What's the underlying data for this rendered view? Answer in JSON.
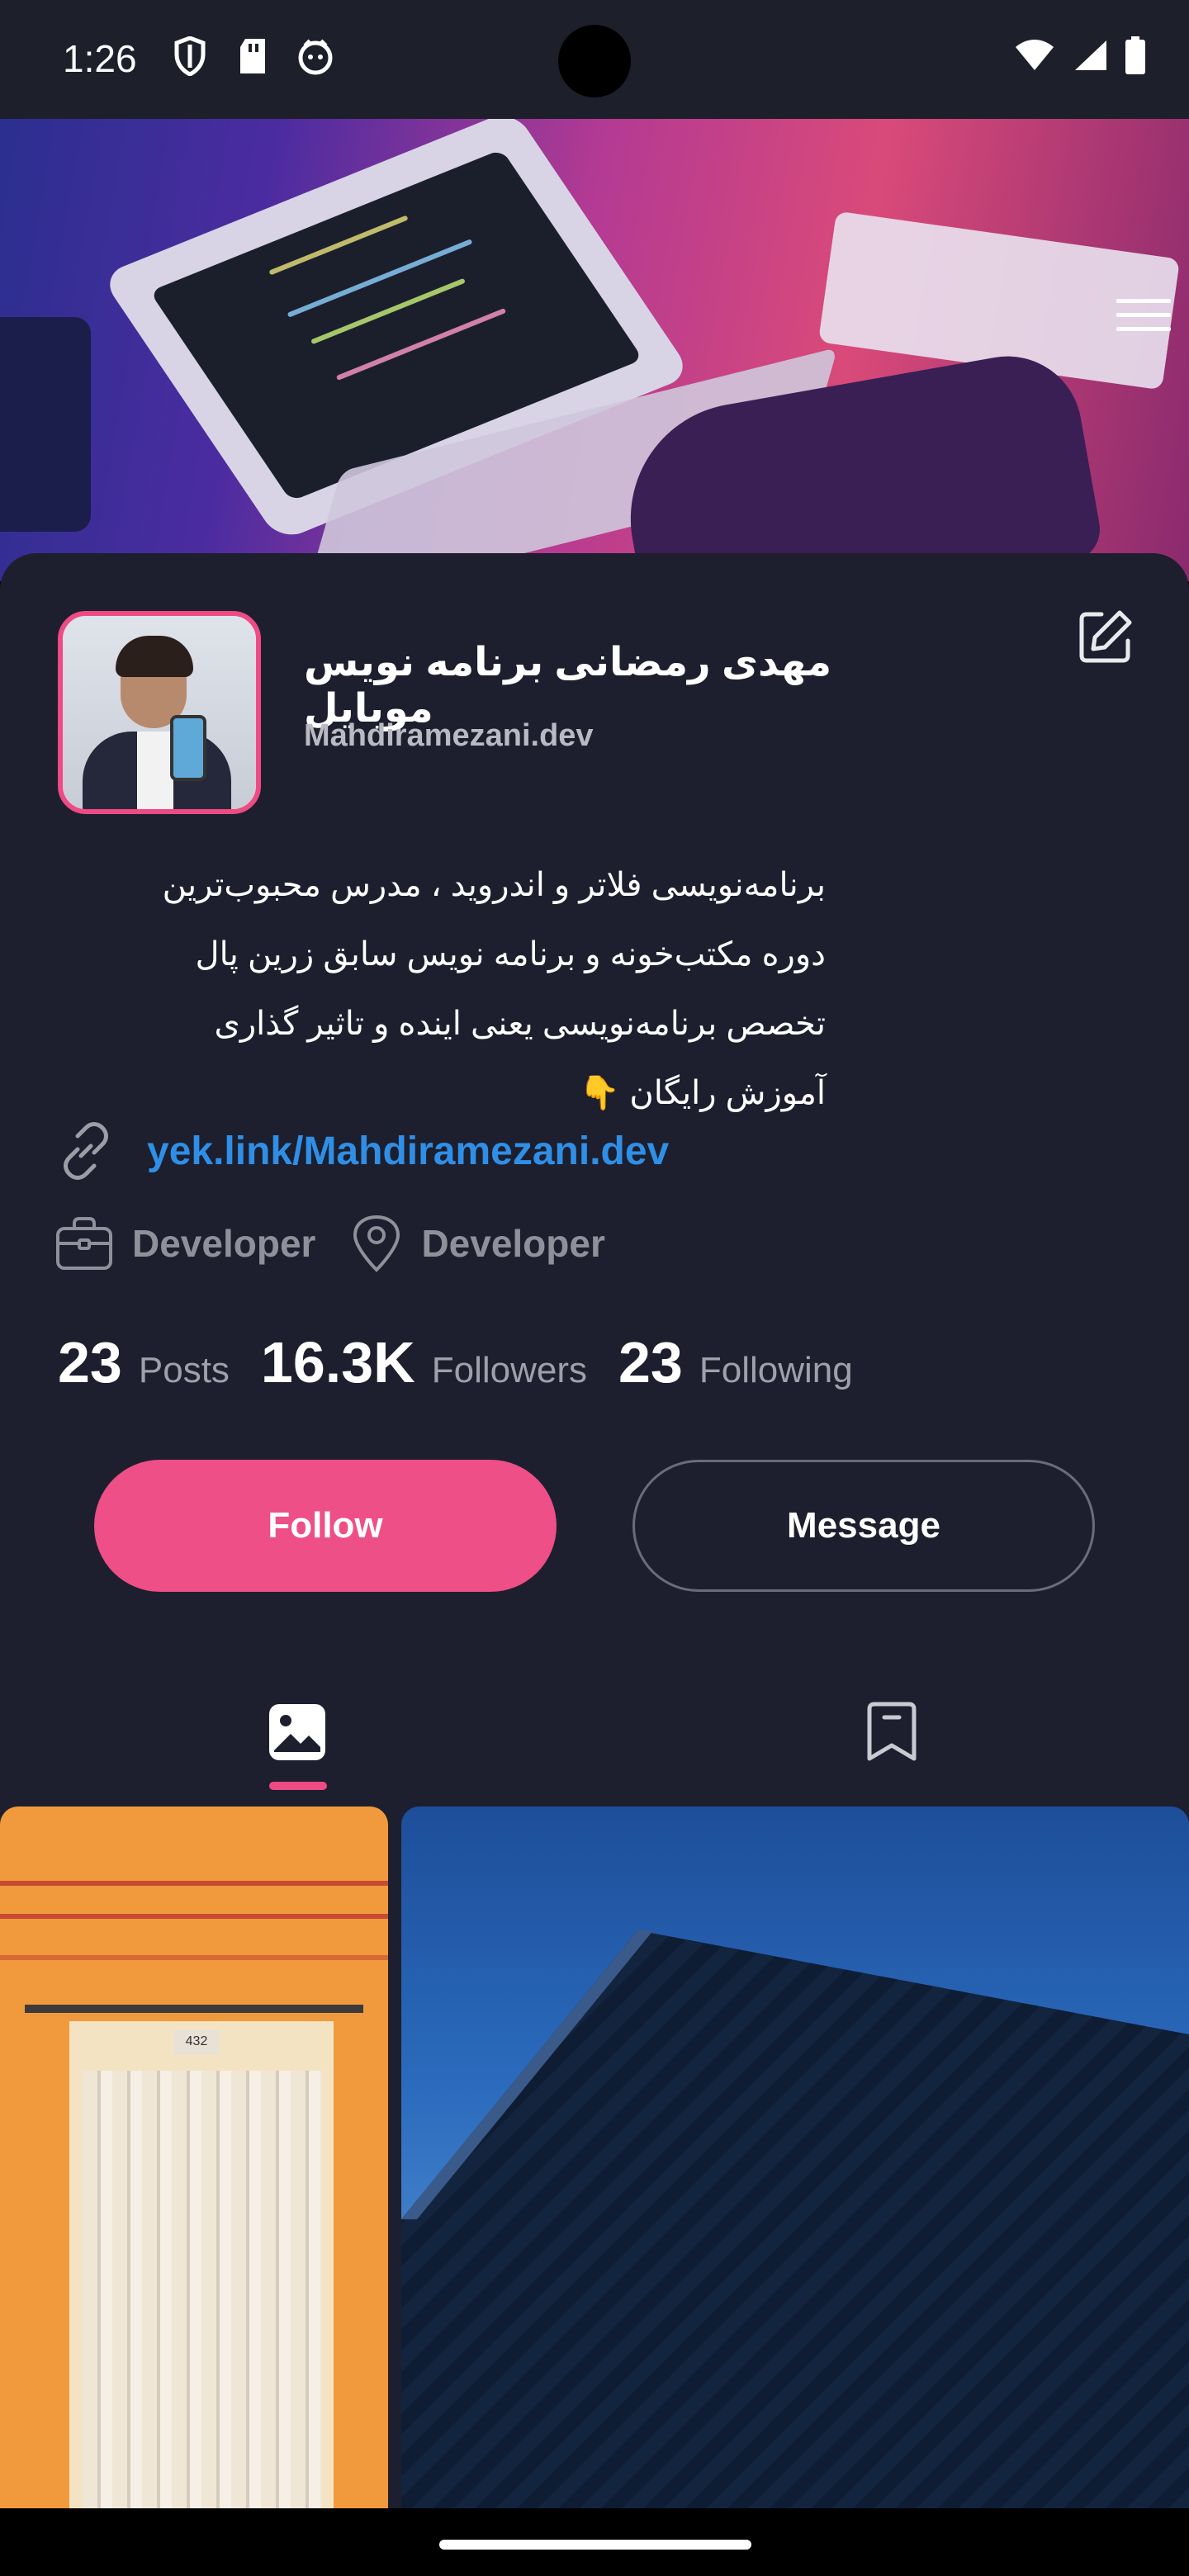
{
  "status_bar": {
    "time": "1:26",
    "left_icons": [
      "shield-icon",
      "sd-card-icon",
      "app-notification-icon"
    ],
    "right_icons": [
      "wifi-icon",
      "signal-icon",
      "battery-icon"
    ]
  },
  "cover": {
    "image": "laptop-coding-cover",
    "menu_icon": "hamburger-menu-icon"
  },
  "profile": {
    "name": "مهدی رمضانی برنامه نویس موبایل",
    "handle": "Mahdiramezani.dev",
    "bio_lines": [
      "برنامه‌نویسی فلاتر و اندروید ، مدرس محبوب‌ترین",
      "دوره مکتب‌خونه و برنامه نویس سابق زرین پال",
      "تخصص برنامه‌نویسی یعنی اینده و تاثیر گذاری",
      "آموزش رایگان 👇"
    ],
    "link": "yek.link/Mahdiramezani.dev",
    "job": "Developer",
    "location": "Developer"
  },
  "stats": {
    "posts": {
      "value": "23",
      "label": "Posts"
    },
    "followers": {
      "value": "16.3K",
      "label": "Followers"
    },
    "following": {
      "value": "23",
      "label": "Following"
    }
  },
  "actions": {
    "follow_label": "Follow",
    "message_label": "Message"
  },
  "tabs": [
    {
      "name": "posts",
      "icon": "image-icon",
      "active": true
    },
    {
      "name": "saved",
      "icon": "bookmark-icon",
      "active": false
    }
  ],
  "grid_tile_a_plate": "432",
  "colors": {
    "accent": "#ee4f86",
    "link": "#2f8fe6",
    "background": "#1d1f2e"
  }
}
